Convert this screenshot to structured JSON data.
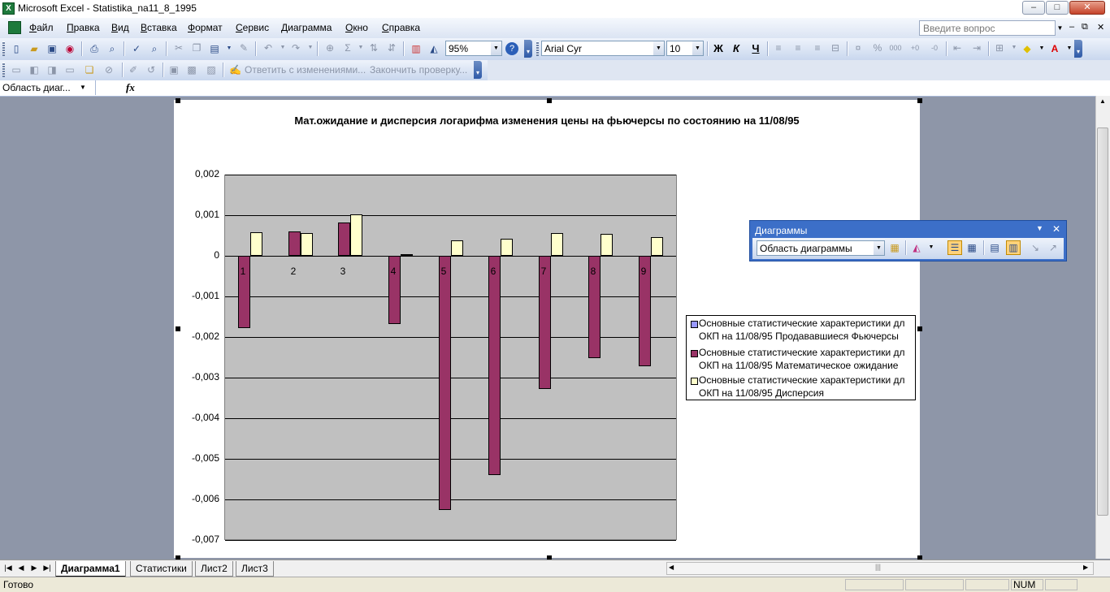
{
  "window": {
    "title": "Microsoft Excel - Statistika_na11_8_1995",
    "minimize": "–",
    "maximize": "□",
    "close": "✕"
  },
  "menu": {
    "items": [
      "Файл",
      "Правка",
      "Вид",
      "Вставка",
      "Формат",
      "Сервис",
      "Диаграмма",
      "Окно",
      "Справка"
    ],
    "ask_placeholder": "Введите вопрос",
    "doc_min": "–",
    "doc_restore": "⧉",
    "doc_close": "✕"
  },
  "toolbar": {
    "zoom": "95%",
    "font": "Arial Cyr",
    "size": "10",
    "bold": "Ж",
    "italic": "К",
    "underline": "Ч"
  },
  "reviewing": {
    "reply": "Ответить с изменениями...",
    "finish": "Закончить проверку..."
  },
  "formula_bar": {
    "name_box": "Область диаг...",
    "fx": "fx"
  },
  "chart_toolbar": {
    "title": "Диаграммы",
    "selection": "Область диаграммы"
  },
  "chart_data": {
    "type": "bar",
    "title": "Мат.ожидание и дисперсия логарифма изменения цены на фьючерсы по состоянию на 11/08/95",
    "categories": [
      "1",
      "2",
      "3",
      "4",
      "5",
      "6",
      "7",
      "8",
      "9"
    ],
    "ylim": [
      -0.007,
      0.002
    ],
    "yticks": [
      "0,002",
      "0,001",
      "0",
      "-0,001",
      "-0,002",
      "-0,003",
      "-0,004",
      "-0,005",
      "-0,006",
      "-0,007"
    ],
    "grid": true,
    "legend_position": "right",
    "series": [
      {
        "name": "Основные статистические характеристики дл",
        "name2": "ОКП на 11/08/95 Продававшиеся Фьючерсы",
        "color": "#9999ff",
        "values": [
          0,
          0,
          0,
          0,
          0,
          0,
          0,
          0,
          0
        ]
      },
      {
        "name": "Основные статистические характеристики дл",
        "name2": "ОКП на 11/08/95 Математическое ожидание",
        "color": "#993366",
        "values": [
          -0.00178,
          0.0006,
          0.00082,
          -0.00168,
          -0.00626,
          -0.0054,
          -0.00328,
          -0.00252,
          -0.00272
        ]
      },
      {
        "name": "Основные статистические характеристики дл",
        "name2": "ОКП на 11/08/95 Дисперсия",
        "color": "#ffffcc",
        "values": [
          0.00058,
          0.00056,
          0.00102,
          4e-05,
          0.00038,
          0.00042,
          0.00056,
          0.00054,
          0.00046
        ]
      }
    ]
  },
  "sheet_tabs": [
    "Диаграмма1",
    "Статистики",
    "Лист2",
    "Лист3"
  ],
  "status": {
    "ready": "Готово",
    "num": "NUM"
  }
}
